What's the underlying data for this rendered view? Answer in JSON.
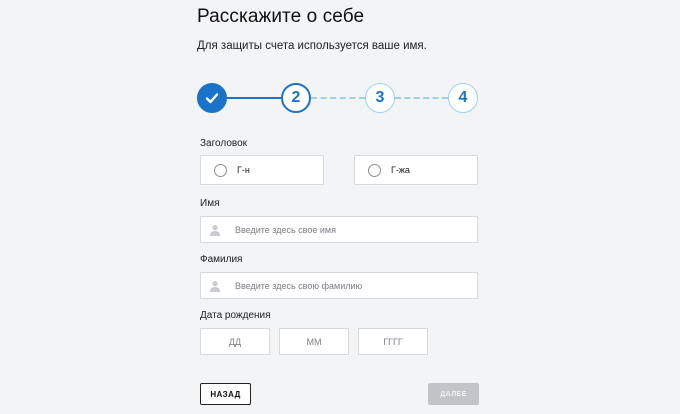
{
  "header": {
    "title": "Расскажите о себе",
    "subtitle": "Для защиты счета используется ваше имя."
  },
  "stepper": {
    "steps": [
      {
        "label": "",
        "state": "completed",
        "icon": "check-icon"
      },
      {
        "label": "2",
        "state": "current"
      },
      {
        "label": "3",
        "state": "upcoming"
      },
      {
        "label": "4",
        "state": "upcoming"
      }
    ],
    "colors": {
      "active": "#1a73c9",
      "upcoming": "#9fd0ea"
    }
  },
  "title_field": {
    "label": "Заголовок",
    "options": [
      {
        "label": "Г-н",
        "selected": false
      },
      {
        "label": "Г-жа",
        "selected": false
      }
    ]
  },
  "first_name": {
    "label": "Имя",
    "placeholder": "Введите здесь свое имя",
    "value": "",
    "icon": "person-icon"
  },
  "last_name": {
    "label": "Фамилия",
    "placeholder": "Введите здесь свою фамилию",
    "value": "",
    "icon": "person-icon"
  },
  "birth_date": {
    "label": "Дата рождения",
    "day_placeholder": "ДД",
    "month_placeholder": "ММ",
    "year_placeholder": "ГГГГ"
  },
  "actions": {
    "back_label": "НАЗАД",
    "next_label": "ДАЛЕЕ",
    "next_enabled": false
  }
}
